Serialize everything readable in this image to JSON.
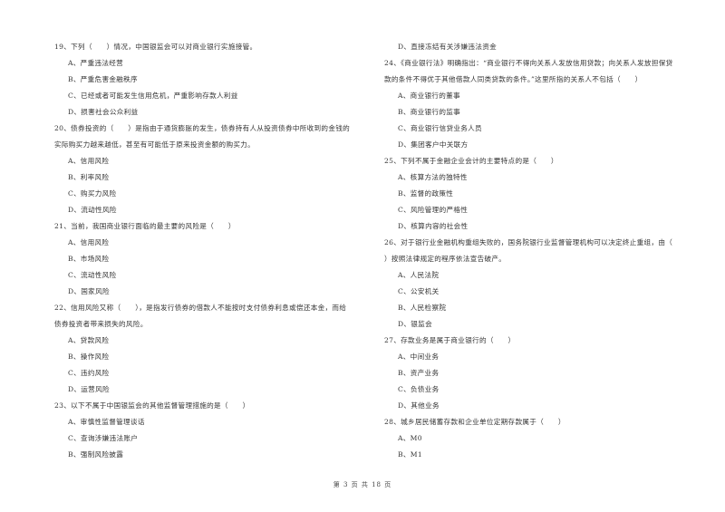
{
  "left_column": [
    {
      "type": "q",
      "text": "19、下列（　　）情况，中国银监会可以对商业银行实施接管。"
    },
    {
      "type": "opt",
      "text": "A、严重违法经营"
    },
    {
      "type": "opt",
      "text": "B、严重危害金融秩序"
    },
    {
      "type": "opt",
      "text": "C、已经或者可能发生信用危机，严重影响存款人利益"
    },
    {
      "type": "opt",
      "text": "D、损害社会公众利益"
    },
    {
      "type": "q",
      "text": "20、债券投资的（　　）是指由于通货膨胀的发生，债券持有人从投资债券中所收到的金钱的"
    },
    {
      "type": "cont",
      "text": "实际购买力越来越低，甚至有可能低于原来投资金额的购买力。"
    },
    {
      "type": "opt",
      "text": "A、信用风险"
    },
    {
      "type": "opt",
      "text": "B、利率风险"
    },
    {
      "type": "opt",
      "text": "C、购买力风险"
    },
    {
      "type": "opt",
      "text": "D、流动性风险"
    },
    {
      "type": "q",
      "text": "21、当前，我国商业银行面临的最主要的风险是（　　）"
    },
    {
      "type": "opt",
      "text": "A、信用风险"
    },
    {
      "type": "opt",
      "text": "B、市场风险"
    },
    {
      "type": "opt",
      "text": "C、流动性风险"
    },
    {
      "type": "opt",
      "text": "D、国家风险"
    },
    {
      "type": "q",
      "text": "22、信用风险又称（　　），是指发行债券的借款人不能按时支付债券利息或偿还本金，而给"
    },
    {
      "type": "cont",
      "text": "债券投资者带来损失的风险。"
    },
    {
      "type": "opt",
      "text": "A、贷款风险"
    },
    {
      "type": "opt",
      "text": "B、操作风险"
    },
    {
      "type": "opt",
      "text": "C、违约风险"
    },
    {
      "type": "opt",
      "text": "D、运营风险"
    },
    {
      "type": "q",
      "text": "23、以下不属于中国银监会的其他监督管理措施的是（　　）"
    },
    {
      "type": "opt",
      "text": "A、审慎性监督管理谈话"
    },
    {
      "type": "opt",
      "text": "C、查询涉嫌违法账户"
    },
    {
      "type": "opt",
      "text": "B、强制风险披露"
    }
  ],
  "right_column": [
    {
      "type": "opt",
      "text": "D、直接冻结有关涉嫌违法资金"
    },
    {
      "type": "q",
      "text": "24、《商业银行法》明确指出：“商业银行不得向关系人发放信用贷款；向关系人发放担保贷"
    },
    {
      "type": "cont",
      "text": "款的条件不得优于其他借款人同类贷款的条件。”这里所指的关系人不包括（　　）"
    },
    {
      "type": "opt",
      "text": "A、商业银行的董事"
    },
    {
      "type": "opt",
      "text": "B、商业银行的监事"
    },
    {
      "type": "opt",
      "text": "C、商业银行信贷业务人员"
    },
    {
      "type": "opt",
      "text": "D、集团客户中关联方"
    },
    {
      "type": "q",
      "text": "25、下列不属于金融企业会计的主要特点的是（　　）"
    },
    {
      "type": "opt",
      "text": "A、核算方法的独特性"
    },
    {
      "type": "opt",
      "text": "B、监督的政策性"
    },
    {
      "type": "opt",
      "text": "C、风险管理的严格性"
    },
    {
      "type": "opt",
      "text": "D、核算内容的社会性"
    },
    {
      "type": "q",
      "text": "26、对于银行业金融机构重组失败的，国务院银行业监督管理机构可以决定终止重组，由（"
    },
    {
      "type": "cont",
      "text": "）按照法律规定的程序依法宣告破产。"
    },
    {
      "type": "opt",
      "text": "A、人民法院"
    },
    {
      "type": "opt",
      "text": "C、公安机关"
    },
    {
      "type": "opt",
      "text": "B、人民检察院"
    },
    {
      "type": "opt",
      "text": "D、银监会"
    },
    {
      "type": "q",
      "text": "27、存款业务是属于商业银行的（　　）"
    },
    {
      "type": "opt",
      "text": "A、中间业务"
    },
    {
      "type": "opt",
      "text": "B、资产业务"
    },
    {
      "type": "opt",
      "text": "C、负债业务"
    },
    {
      "type": "opt",
      "text": "D、其他业务"
    },
    {
      "type": "q",
      "text": "28、城乡居民储蓄存款和企业单位定期存款属于（　　）"
    },
    {
      "type": "opt",
      "text": "A、M0"
    },
    {
      "type": "opt",
      "text": "B、M1"
    }
  ],
  "footer": {
    "page_label": "第 3 页 共 18 页"
  }
}
